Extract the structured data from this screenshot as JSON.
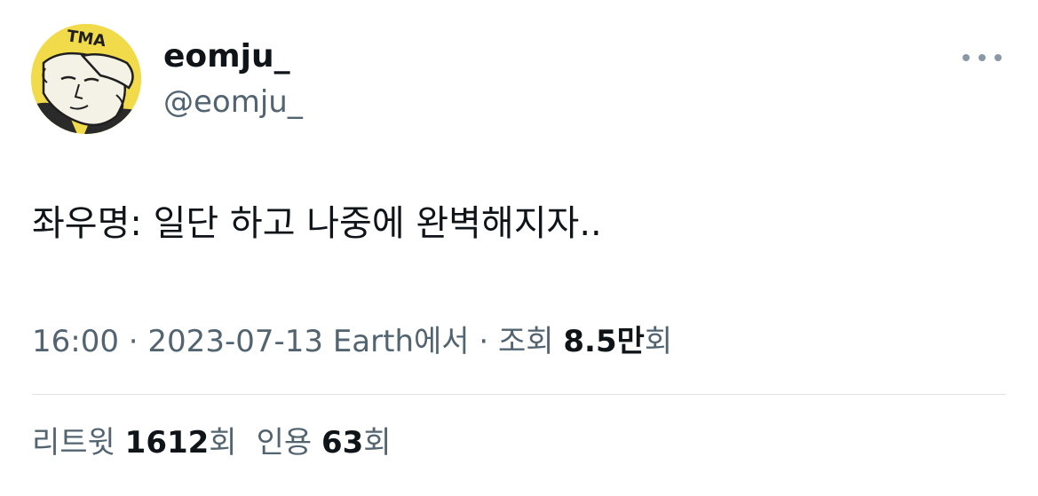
{
  "user": {
    "display_name": "eomju_",
    "handle": "@eomju_"
  },
  "tweet": {
    "text": "좌우명: 일단 하고 나중에 완벽해지자.."
  },
  "meta": {
    "time": "16:00",
    "separator1": " · ",
    "date": "2023-07-13",
    "source": " Earth에서",
    "separator2": " · ",
    "views_label": "조회 ",
    "views_value": "8.5만",
    "views_suffix": "회"
  },
  "stats": {
    "retweets_label": "리트윗 ",
    "retweets_value": "1612",
    "retweets_suffix": "회",
    "quotes_label": "인용 ",
    "quotes_value": "63",
    "quotes_suffix": "회"
  },
  "icons": {
    "more": "more-horizontal-icon"
  },
  "colors": {
    "text_primary": "#0f1419",
    "text_secondary": "#536471",
    "divider": "#dfe3e6",
    "avatar_bg": "#f2db4a"
  }
}
